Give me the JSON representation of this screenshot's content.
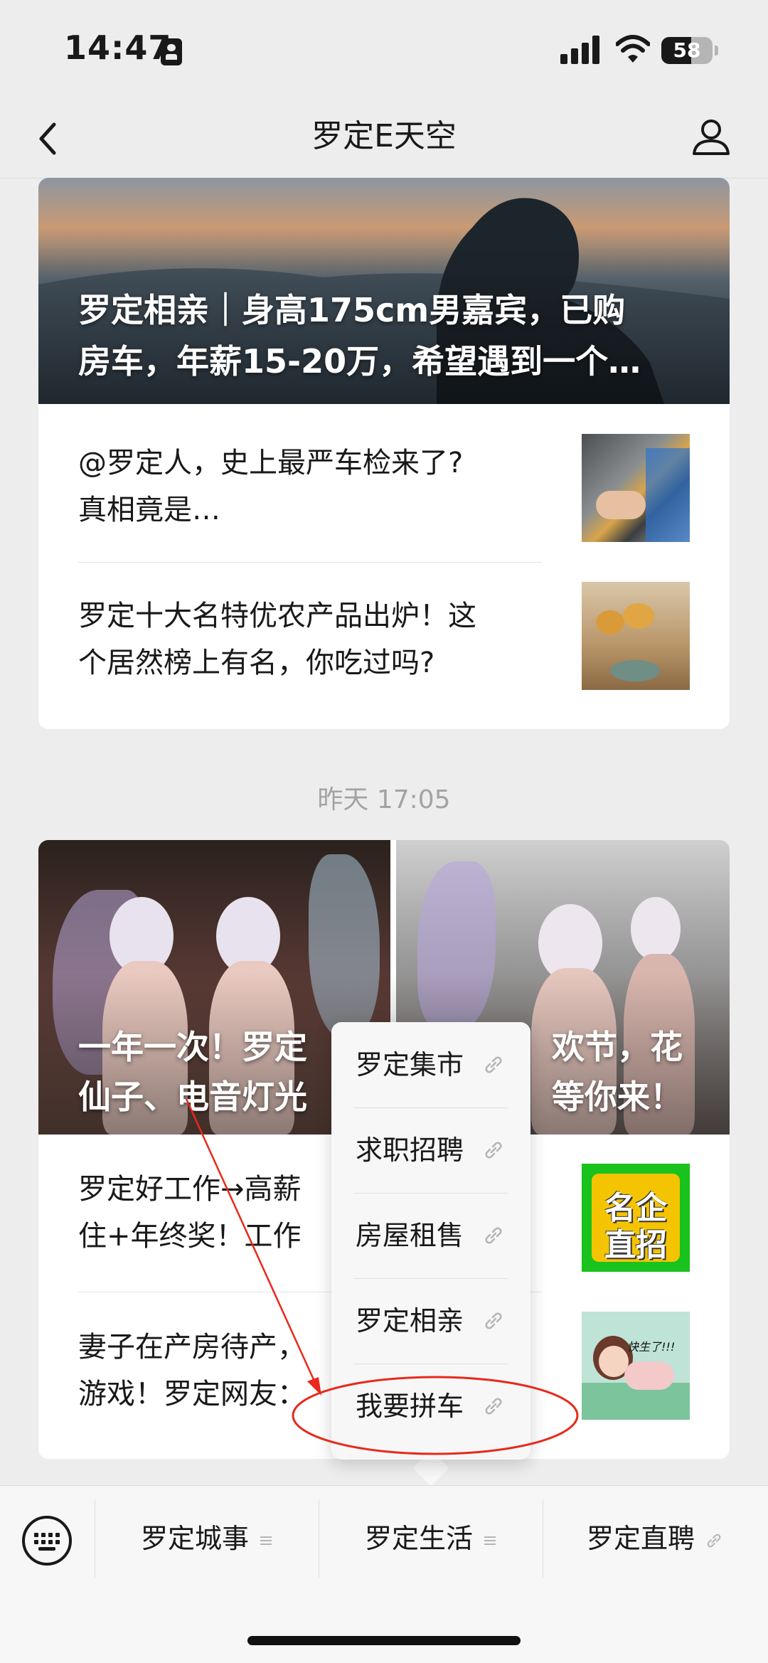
{
  "status_bar": {
    "time": "14:47",
    "battery": "58",
    "battery_level": 0.58
  },
  "nav": {
    "title": "罗定E天空"
  },
  "group1": {
    "cover_title_line1": "罗定相亲｜身高175cm男嘉宾，已购",
    "cover_title_line2": "房车，年薪15-20万，希望遇到一个…",
    "articles": [
      {
        "line1": "@罗定人，史上最严车检来了?",
        "line2": "真相竟是…"
      },
      {
        "line1": "罗定十大名特优农产品出炉！这",
        "line2": "个居然榜上有名，你吃过吗?"
      }
    ]
  },
  "timestamp": "昨天 17:05",
  "group2": {
    "cover_title_line1": "一年一次！罗定",
    "cover_title_line1b": "欢节，花",
    "cover_title_line2": "仙子、电音灯光",
    "cover_title_line2b": "等你来！",
    "articles": [
      {
        "line1": "罗定好工作→高薪",
        "line2": "住+年终奖！工作",
        "thumb_text1": "名企",
        "thumb_text2": "直招"
      },
      {
        "line1": "妻子在产房待产，",
        "line2": "游戏！罗定网友：",
        "thumb_text": "快生了!!!"
      }
    ]
  },
  "popup_menu": {
    "items": [
      {
        "label": "罗定集市"
      },
      {
        "label": "求职招聘"
      },
      {
        "label": "房屋租售"
      },
      {
        "label": "罗定相亲"
      },
      {
        "label": "我要拼车"
      }
    ]
  },
  "bottom_menu": {
    "items": [
      {
        "label": "罗定城事"
      },
      {
        "label": "罗定生活"
      },
      {
        "label": "罗定直聘"
      }
    ]
  },
  "colors": {
    "annotation": "#e8291b",
    "thumb_green": "#19c21c",
    "thumb_yellow": "#f5c400"
  }
}
